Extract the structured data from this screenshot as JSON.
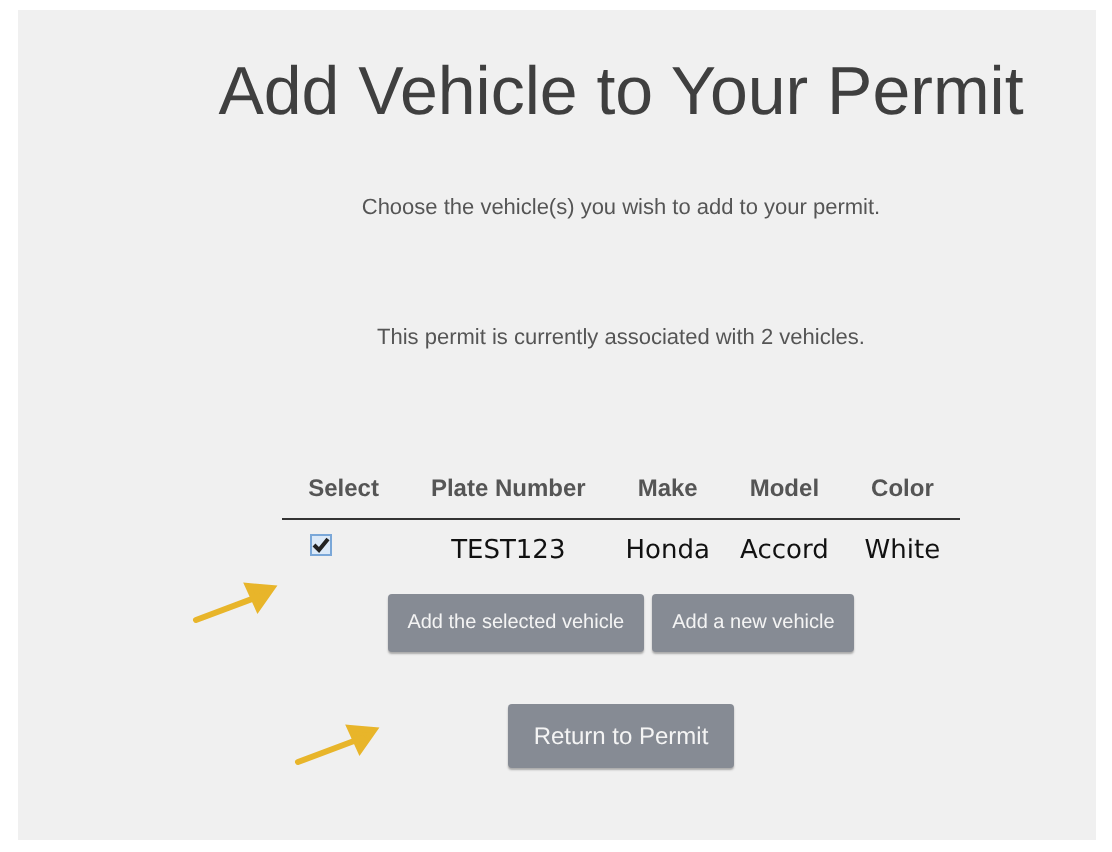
{
  "title": "Add Vehicle to Your Permit",
  "instruction": "Choose the vehicle(s) you wish to add to your permit.",
  "association_note": "This permit is currently associated with 2 vehicles.",
  "table": {
    "columns": [
      "Select",
      "Plate Number",
      "Make",
      "Model",
      "Color"
    ],
    "rows": [
      {
        "selected": true,
        "plate": "TEST123",
        "make": "Honda",
        "model": "Accord",
        "vehicle_color": "White"
      }
    ]
  },
  "actions": [
    "Add the selected vehicle",
    "Add a new vehicle"
  ],
  "return_button": "Return to Permit"
}
